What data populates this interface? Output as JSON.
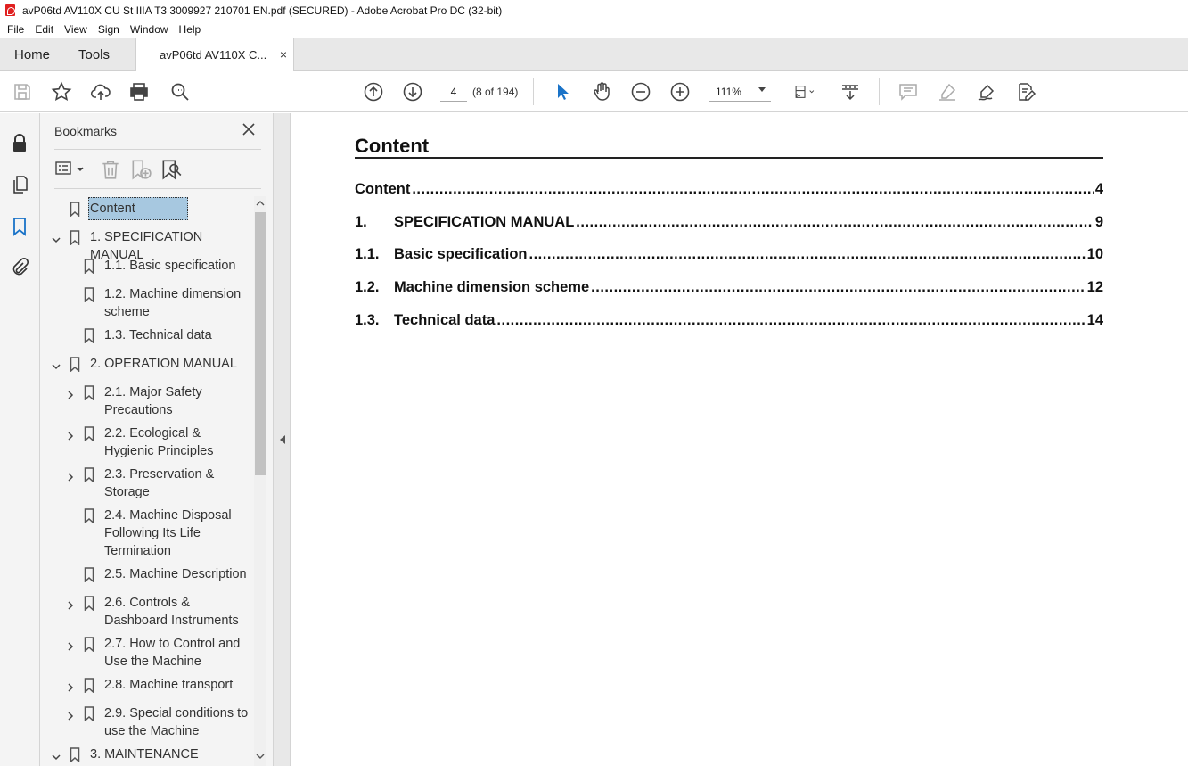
{
  "window": {
    "title": "avP06td AV110X CU St IIIA T3 3009927 210701 EN.pdf (SECURED) - Adobe Acrobat Pro DC (32-bit)"
  },
  "menu": [
    "File",
    "Edit",
    "View",
    "Sign",
    "Window",
    "Help"
  ],
  "tabs": {
    "home": "Home",
    "tools": "Tools",
    "document": "avP06td AV110X C...",
    "close": "×"
  },
  "toolbar": {
    "page_number": "4",
    "page_count": "(8 of 194)",
    "zoom": "111%"
  },
  "bookmarks": {
    "title": "Bookmarks",
    "items": [
      {
        "label": "Content",
        "level": 0,
        "expander": "none",
        "selected": true
      },
      {
        "label": "1. SPECIFICATION MANUAL",
        "level": 0,
        "expander": "expanded"
      },
      {
        "label": "1.1. Basic specification",
        "level": 1,
        "expander": "none"
      },
      {
        "label": "1.2. Machine dimension",
        "label2": "scheme",
        "level": 1,
        "expander": "none"
      },
      {
        "label": "1.3. Technical data",
        "level": 1,
        "expander": "none"
      },
      {
        "label": "2. OPERATION MANUAL",
        "level": 0,
        "expander": "expanded"
      },
      {
        "label": "2.1. Major Safety",
        "label2": "Precautions",
        "level": 1,
        "expander": "collapsed"
      },
      {
        "label": "2.2. Ecological &",
        "label2": "Hygienic Principles",
        "level": 1,
        "expander": "collapsed"
      },
      {
        "label": "2.3. Preservation &",
        "label2": "Storage",
        "level": 1,
        "expander": "collapsed"
      },
      {
        "label": "2.4. Machine Disposal",
        "label2": "Following Its Life",
        "label3": "Termination",
        "level": 1,
        "expander": "none"
      },
      {
        "label": "2.5. Machine Description",
        "level": 1,
        "expander": "none"
      },
      {
        "label": "2.6. Controls &",
        "label2": "Dashboard Instruments",
        "level": 1,
        "expander": "collapsed"
      },
      {
        "label": "2.7. How to Control and",
        "label2": "Use the Machine",
        "level": 1,
        "expander": "collapsed"
      },
      {
        "label": "2.8. Machine transport",
        "level": 1,
        "expander": "collapsed"
      },
      {
        "label": "2.9. Special conditions to",
        "label2": "use the Machine",
        "level": 1,
        "expander": "collapsed"
      },
      {
        "label": "3. MAINTENANCE",
        "level": 0,
        "expander": "expanded"
      }
    ]
  },
  "document": {
    "heading": "Content",
    "toc": [
      {
        "num": "",
        "title": "Content",
        "page": "4"
      },
      {
        "num": "1.",
        "title": "SPECIFICATION MANUAL",
        "page": "9"
      },
      {
        "num": "1.1.",
        "title": "Basic specification",
        "page": "10"
      },
      {
        "num": "1.2.",
        "title": "Machine dimension scheme",
        "page": "12"
      },
      {
        "num": "1.3.",
        "title": "Technical data",
        "page": "14"
      }
    ]
  }
}
